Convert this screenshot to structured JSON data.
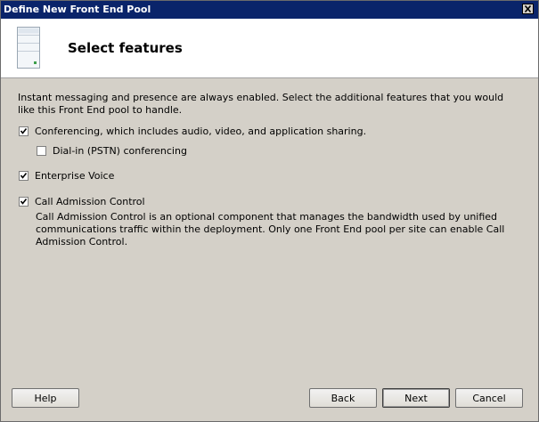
{
  "window": {
    "title": "Define New Front End Pool"
  },
  "header": {
    "title": "Select features"
  },
  "intro_text": "Instant messaging and presence are always enabled.  Select the additional features that you would like this Front End pool to handle.",
  "options": {
    "conferencing": {
      "label": "Conferencing, which includes audio, video, and application sharing.",
      "checked": true
    },
    "dialin": {
      "label": "Dial-in (PSTN) conferencing",
      "checked": false
    },
    "enterprise_voice": {
      "label": "Enterprise Voice",
      "checked": true
    },
    "call_admission": {
      "label": "Call Admission Control",
      "checked": true
    }
  },
  "call_admission_description": "Call Admission Control is an optional component that manages the bandwidth used by unified communications traffic within the deployment.  Only one Front End pool per site can enable Call Admission Control.",
  "buttons": {
    "help": "Help",
    "back": "Back",
    "next": "Next",
    "cancel": "Cancel"
  },
  "colors": {
    "titlebar": "#0a246a",
    "dialog_background": "#d4d0c8",
    "header_background": "#ffffff"
  },
  "icons": {
    "header": "server-icon",
    "close": "close-icon"
  }
}
